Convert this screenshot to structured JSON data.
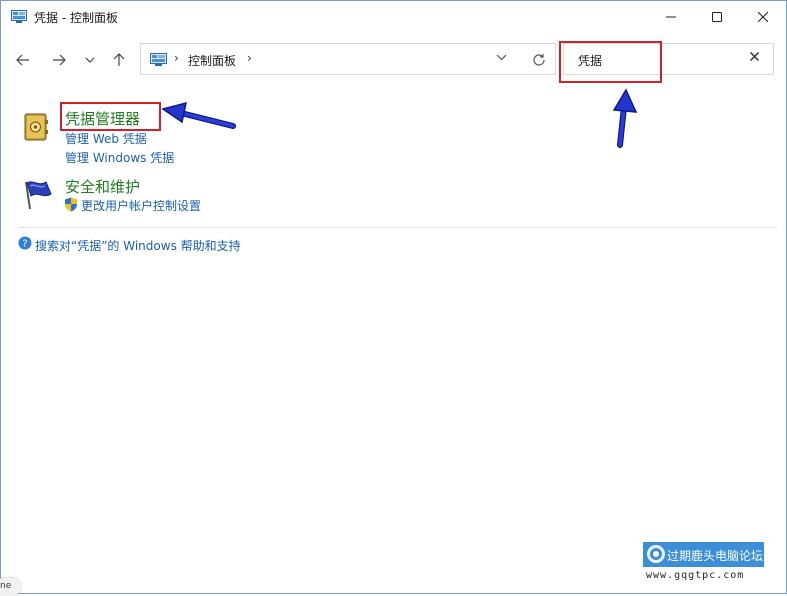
{
  "window": {
    "title": "凭据 - 控制面板",
    "app_icon": "control-panel-icon"
  },
  "window_controls": {
    "minimize_icon": "minimize-icon",
    "maximize_icon": "maximize-icon",
    "close_icon": "close-icon"
  },
  "nav": {
    "back_icon": "arrow-left-icon",
    "forward_icon": "arrow-right-icon",
    "recent_icon": "chevron-down-icon",
    "up_icon": "arrow-up-icon"
  },
  "address": {
    "icon": "control-panel-icon",
    "breadcrumb": "控制面板",
    "separator": "›",
    "dropdown_icon": "chevron-down-icon",
    "refresh_icon": "refresh-icon"
  },
  "search": {
    "value": "凭据",
    "clear_icon": "close-icon"
  },
  "results": [
    {
      "icon": "credential-vault-icon",
      "title": "凭据管理器",
      "links": [
        "管理 Web 凭据",
        "管理 Windows 凭据"
      ]
    },
    {
      "icon": "security-flag-icon",
      "title": "安全和维护",
      "links": [
        "更改用户帐户控制设置"
      ],
      "link_icon": "uac-shield-icon"
    }
  ],
  "help": {
    "icon": "help-icon",
    "text": "搜索对“凭据”的 Windows 帮助和支持"
  },
  "annotations": {
    "highlight_color": "#d0202a",
    "arrow_color": "#1a2fc8"
  },
  "watermark": {
    "text": "过期鹿头电脑论坛",
    "url": "www.gqgtpc.com",
    "banner_color": "#3c8fd6"
  },
  "corner_tab": {
    "text": "ne"
  },
  "colors": {
    "title_green": "#1f7d1f",
    "link_blue": "#1a5fb4"
  }
}
